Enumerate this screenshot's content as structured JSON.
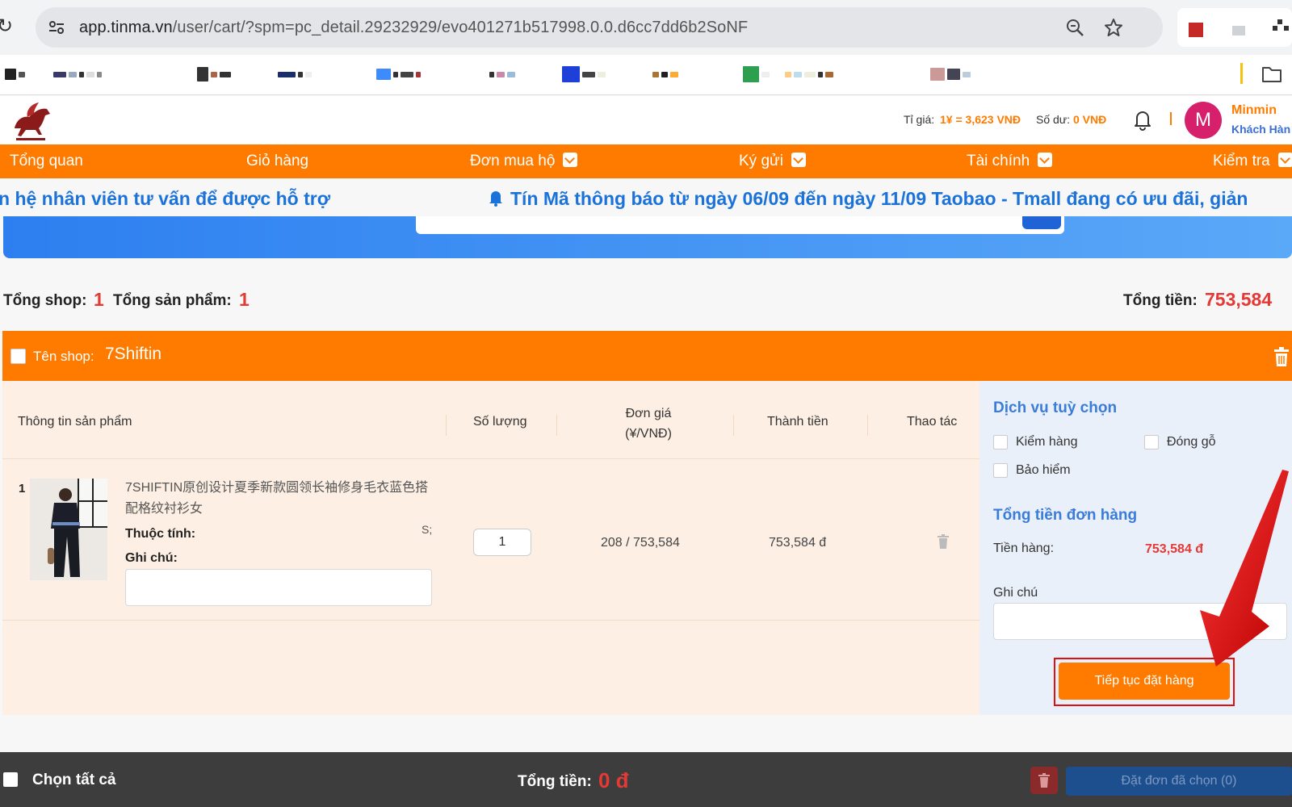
{
  "browser": {
    "url_host": "app.tinma.vn",
    "url_path": "/user/cart/?spm=pc_detail.29232929/evo401271b517998.0.0.d6cc7dd6b2SoNF",
    "icons": [
      "reload-icon",
      "site-info-icon",
      "zoom-icon",
      "bookmark-star-icon",
      "folder-icon"
    ]
  },
  "header": {
    "rate_label": "Tỉ giá:",
    "rate_value": "1¥ = 3,623 VNĐ",
    "balance_label": "Số dư:",
    "balance_value": "0 VNĐ",
    "avatar_initial": "M",
    "user_name": "Minmin",
    "user_role": "Khách Hàn"
  },
  "nav": {
    "items": [
      {
        "label": "Tổng quan",
        "dropdown": false
      },
      {
        "label": "Giỏ hàng",
        "dropdown": false
      },
      {
        "label": "Đơn mua hộ",
        "dropdown": true
      },
      {
        "label": "Ký gửi",
        "dropdown": true
      },
      {
        "label": "Tài chính",
        "dropdown": true
      },
      {
        "label": "Kiểm tra",
        "dropdown": true
      }
    ]
  },
  "marquee": {
    "text_left": "n hệ nhân viên tư vấn để được hỗ trợ",
    "text_right": "Tín Mã thông báo từ ngày 06/09 đến ngày 11/09 Taobao - Tmall đang có ưu đãi, giản"
  },
  "summary": {
    "shop_label": "Tổng shop:",
    "shop_count": "1",
    "product_label": "Tổng sản phẩm:",
    "product_count": "1",
    "total_label": "Tổng tiền:",
    "total_value": "753,584"
  },
  "shop": {
    "label": "Tên shop:",
    "name": "7Shiftin"
  },
  "table": {
    "headers": {
      "product": "Thông tin sản phẩm",
      "qty": "Số lượng",
      "price_line1": "Đơn giá",
      "price_line2": "(¥/VNĐ)",
      "amount": "Thành tiền",
      "action": "Thao tác"
    },
    "rows": [
      {
        "index": "1",
        "name": "7SHIFTIN原创设计夏季新款圆领长袖修身毛衣蓝色搭配格纹衬衫女",
        "attr_label": "Thuộc tính:",
        "attr_value": "S;",
        "note_label": "Ghi chú:",
        "qty": "1",
        "price": "208 / 753,584",
        "amount": "753,584 đ"
      }
    ]
  },
  "panel": {
    "services_title": "Dịch vụ tuỳ chọn",
    "options": [
      "Kiểm hàng",
      "Đóng gỗ",
      "Bảo hiểm"
    ],
    "total_title": "Tổng tiền đơn hàng",
    "goods_label": "Tiền hàng:",
    "goods_value": "753,584 đ",
    "note_label": "Ghi chú",
    "continue_button": "Tiếp tục đặt hàng"
  },
  "bottom": {
    "select_all": "Chọn tất cả",
    "total_label": "Tổng tiền:",
    "total_value": "0 đ",
    "order_button": "Đặt đơn đã chọn (0)"
  },
  "colors": {
    "accent_orange": "#ff7b00",
    "price_red": "#e53935",
    "link_blue": "#3a7cd8",
    "annotation_red": "#e01010"
  }
}
